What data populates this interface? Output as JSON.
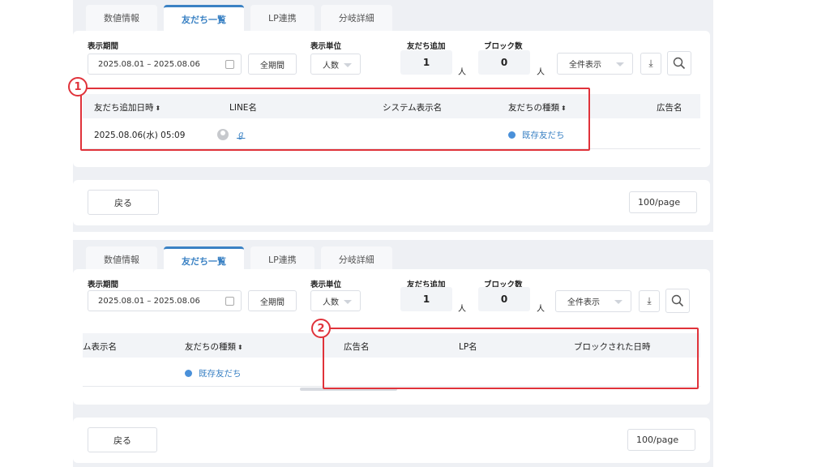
{
  "tabs": [
    "数値情報",
    "友だち一覧",
    "LP連携",
    "分岐詳細"
  ],
  "filters": {
    "period_label": "表示期間",
    "period_value": "2025.08.01 – 2025.08.06",
    "all_period_button": "全期間",
    "unit_label": "表示単位",
    "unit_value": "人数",
    "friend_add_label": "友だち追加",
    "friend_add_value": "1",
    "block_label": "ブロック数",
    "block_value": "0",
    "person_unit": "人",
    "display_all": "全件表示"
  },
  "table": {
    "headers": {
      "added_at": "友だち追加日時",
      "line_name": "LINE名",
      "system_name": "システム表示名",
      "system_name_clipped": "ム表示名",
      "friend_type": "友だちの種類",
      "ad_name": "広告名",
      "lp_name": "LP名",
      "blocked_at": "ブロックされた日時"
    },
    "row": {
      "added_at": "2025.08.06(水) 05:09",
      "line_name": "ℊ",
      "friend_type": "既存友だち"
    }
  },
  "footer": {
    "back_button": "戻る",
    "page_size": "100/page"
  },
  "annotations": [
    "1",
    "2"
  ],
  "colors": {
    "accent": "#3b82c4",
    "highlight": "#e0323a"
  }
}
